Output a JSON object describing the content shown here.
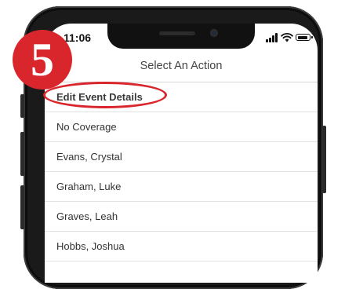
{
  "annotation": {
    "step_number": "5",
    "accent_color": "#d9262c"
  },
  "status_bar": {
    "time": "11:06",
    "icons": [
      "signal-icon",
      "wifi-icon",
      "battery-icon"
    ]
  },
  "action_sheet": {
    "title": "Select An Action",
    "items": [
      {
        "label": "Edit Event Details"
      },
      {
        "label": "No Coverage"
      },
      {
        "label": "Evans, Crystal"
      },
      {
        "label": "Graham, Luke"
      },
      {
        "label": "Graves, Leah"
      },
      {
        "label": "Hobbs, Joshua"
      }
    ]
  }
}
